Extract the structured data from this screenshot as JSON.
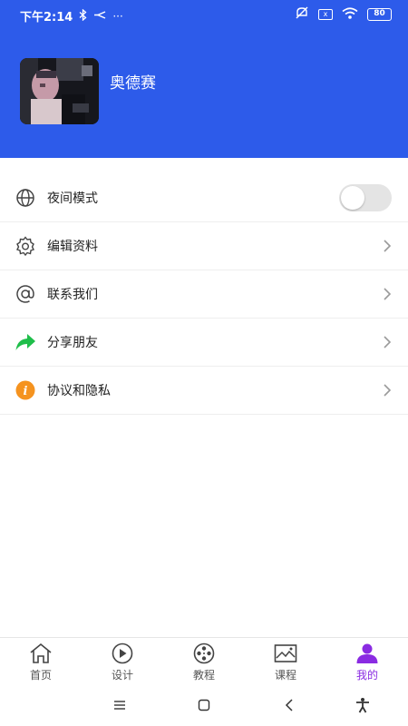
{
  "status_bar": {
    "time": "下午2:14",
    "icons": [
      "bluetooth-icon",
      "cast-icon",
      "more-dots-icon",
      "mute-icon",
      "sim-icon",
      "wifi-icon",
      "battery-icon"
    ],
    "more": "···",
    "sim_label": "x",
    "battery": "80"
  },
  "profile": {
    "username": "奥德赛"
  },
  "menu": {
    "items": [
      {
        "label": "夜间模式",
        "icon": "globe-icon",
        "control": "toggle",
        "checked": false
      },
      {
        "label": "编辑资料",
        "icon": "gear-icon",
        "control": "chevron"
      },
      {
        "label": "联系我们",
        "icon": "at-icon",
        "control": "chevron"
      },
      {
        "label": "分享朋友",
        "icon": "share-arrow-icon",
        "control": "chevron"
      },
      {
        "label": "协议和隐私",
        "icon": "info-icon",
        "control": "chevron"
      }
    ],
    "info_glyph": "i"
  },
  "tabbar": {
    "tabs": [
      {
        "label": "首页",
        "icon": "home-icon",
        "active": false
      },
      {
        "label": "设计",
        "icon": "play-circle-icon",
        "active": false
      },
      {
        "label": "教程",
        "icon": "film-reel-icon",
        "active": false
      },
      {
        "label": "课程",
        "icon": "picture-icon",
        "active": false
      },
      {
        "label": "我的",
        "icon": "person-icon",
        "active": true
      }
    ]
  },
  "colors": {
    "header": "#2d5bea",
    "active_tab": "#8a2be2",
    "share_green": "#1fbe4a",
    "info_orange": "#f5931f"
  }
}
